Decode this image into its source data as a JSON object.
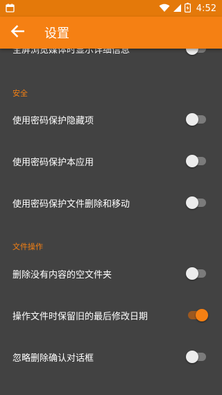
{
  "status_bar": {
    "time": "4:52",
    "left_icon": "calendar-icon",
    "icons": [
      "wifi-icon",
      "signal-icon",
      "battery-icon"
    ]
  },
  "app_bar": {
    "title": "设置",
    "back_icon": "arrow-left-icon"
  },
  "colors": {
    "accent": "#f58013",
    "status_bar": "#e4790a",
    "background": "#424242"
  },
  "settings": {
    "partial_item": {
      "label": "全屏浏览媒体时显示详细信息",
      "enabled": false
    },
    "security": {
      "header": "安全",
      "items": [
        {
          "label": "使用密码保护隐藏项",
          "enabled": false
        },
        {
          "label": "使用密码保护本应用",
          "enabled": false
        },
        {
          "label": "使用密码保护文件删除和移动",
          "enabled": false
        }
      ]
    },
    "file_operations": {
      "header": "文件操作",
      "items": [
        {
          "label": "删除没有内容的空文件夹",
          "enabled": false
        },
        {
          "label": "操作文件时保留旧的最后修改日期",
          "enabled": true
        },
        {
          "label": "忽略删除确认对话框",
          "enabled": false
        }
      ]
    }
  }
}
